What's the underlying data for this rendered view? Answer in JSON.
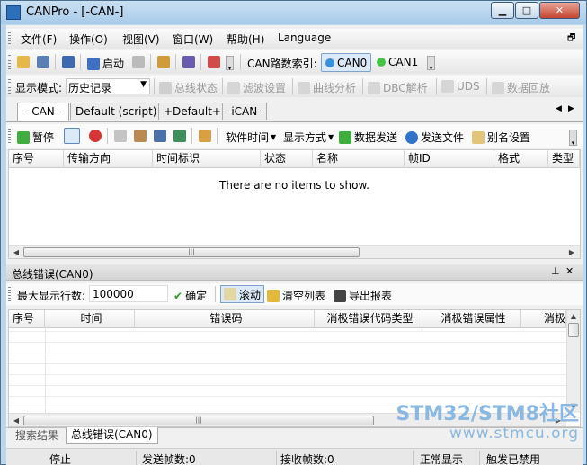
{
  "window": {
    "title": "CANPro - [-CAN-]"
  },
  "menu": [
    "文件(F)",
    "操作(O)",
    "视图(V)",
    "窗口(W)",
    "帮助(H)",
    "Language"
  ],
  "toolbar1": {
    "start": "启动",
    "can_index_label": "CAN路数索引:",
    "can0": "CAN0",
    "can1": "CAN1"
  },
  "toolbar2": {
    "display_mode_label": "显示模式:",
    "display_mode_value": "历史记录",
    "bus_status": "总线状态",
    "filter_settings": "滤波设置",
    "curve_analysis": "曲线分析",
    "dbc_parse": "DBC解析",
    "uds": "UDS",
    "data_replay": "数据回放"
  },
  "doc_tabs": [
    "-CAN-",
    "Default (script)",
    "+Default+",
    "-iCAN-"
  ],
  "doc_toolbar": {
    "pause": "暂停",
    "software_time": "软件时间",
    "display_mode": "显示方式",
    "data_send": "数据发送",
    "send_file": "发送文件",
    "alias_settings": "别名设置"
  },
  "grid1": {
    "columns": [
      "序号",
      "传输方向",
      "时间标识",
      "状态",
      "名称",
      "帧ID",
      "格式",
      "类型"
    ],
    "empty_text": "There are no items to show."
  },
  "bus_error_panel": {
    "title": "总线错误(CAN0)",
    "max_rows_label": "最大显示行数:",
    "max_rows_value": "100000",
    "confirm": "确定",
    "scroll": "滚动",
    "clear_list": "清空列表",
    "export_report": "导出报表"
  },
  "grid2": {
    "columns": [
      "序号",
      "时间",
      "错误码",
      "消极错误代码类型",
      "消极错误属性",
      "消极"
    ]
  },
  "bottom_tabs": [
    "搜索结果",
    "总线错误(CAN0)"
  ],
  "status": {
    "state": "停止",
    "sent": "发送帧数:0",
    "received": "接收帧数:0",
    "display": "正常显示",
    "trigger": "触发已禁用"
  },
  "watermark": {
    "line1": "STM32/STM8社区",
    "line2": "www.stmcu.org"
  },
  "colors": {
    "titlebar": "#a9cbea",
    "close": "#c4452f",
    "can_active": "#3a8fd8",
    "can_ok": "#43c443",
    "watermark": "#8ab8e0"
  },
  "icons": {
    "app": "app-icon",
    "open": "folder-open-icon",
    "save": "save-icon",
    "play": "start-icon",
    "pause": "pause-icon",
    "help": "help-icon",
    "info": "info-icon"
  }
}
